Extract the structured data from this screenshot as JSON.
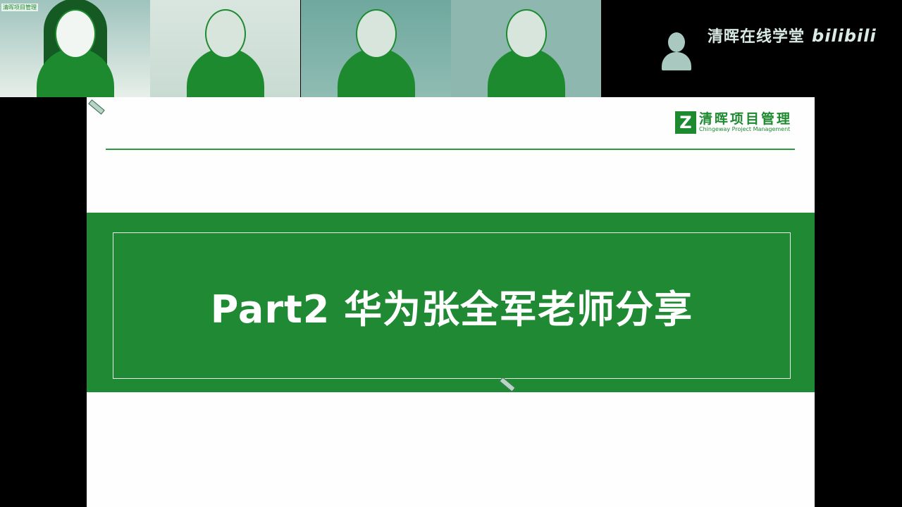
{
  "participants": [
    {
      "name_tag": "清晖项目管理"
    },
    {},
    {},
    {},
    {
      "camera": "off"
    }
  ],
  "watermark": {
    "text": "清晖在线学堂",
    "brand": "bilibili"
  },
  "slide": {
    "logo_cn": "清晖项目管理",
    "logo_en": "Chingeway Project Management",
    "logo_mark": "Z",
    "title": "Part2 华为张全军老师分享"
  },
  "colors": {
    "accent": "#1f8a33"
  }
}
